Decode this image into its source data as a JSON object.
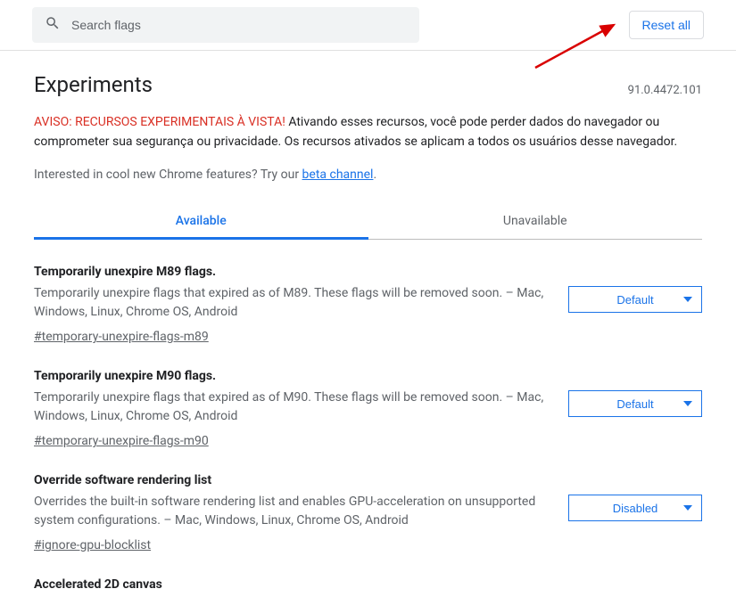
{
  "top": {
    "search_placeholder": "Search flags",
    "reset_label": "Reset all"
  },
  "header": {
    "title": "Experiments",
    "version": "91.0.4472.101"
  },
  "warning": {
    "red": "AVISO: RECURSOS EXPERIMENTAIS À VISTA!",
    "text": " Ativando esses recursos, você pode perder dados do navegador ou comprometer sua segurança ou privacidade. Os recursos ativados se aplicam a todos os usuários desse navegador."
  },
  "promo": {
    "prefix": "Interested in cool new Chrome features? Try our ",
    "link_text": "beta channel",
    "suffix": "."
  },
  "tabs": {
    "available": "Available",
    "unavailable": "Unavailable"
  },
  "flags": [
    {
      "title": "Temporarily unexpire M89 flags.",
      "desc": "Temporarily unexpire flags that expired as of M89. These flags will be removed soon. – Mac, Windows, Linux, Chrome OS, Android",
      "anchor": "#temporary-unexpire-flags-m89",
      "select": "Default"
    },
    {
      "title": "Temporarily unexpire M90 flags.",
      "desc": "Temporarily unexpire flags that expired as of M90. These flags will be removed soon. – Mac, Windows, Linux, Chrome OS, Android",
      "anchor": "#temporary-unexpire-flags-m90",
      "select": "Default"
    },
    {
      "title": "Override software rendering list",
      "desc": "Overrides the built-in software rendering list and enables GPU-acceleration on unsupported system configurations. – Mac, Windows, Linux, Chrome OS, Android",
      "anchor": "#ignore-gpu-blocklist",
      "select": "Disabled"
    },
    {
      "title": "Accelerated 2D canvas",
      "desc": "",
      "anchor": "",
      "select": ""
    }
  ]
}
